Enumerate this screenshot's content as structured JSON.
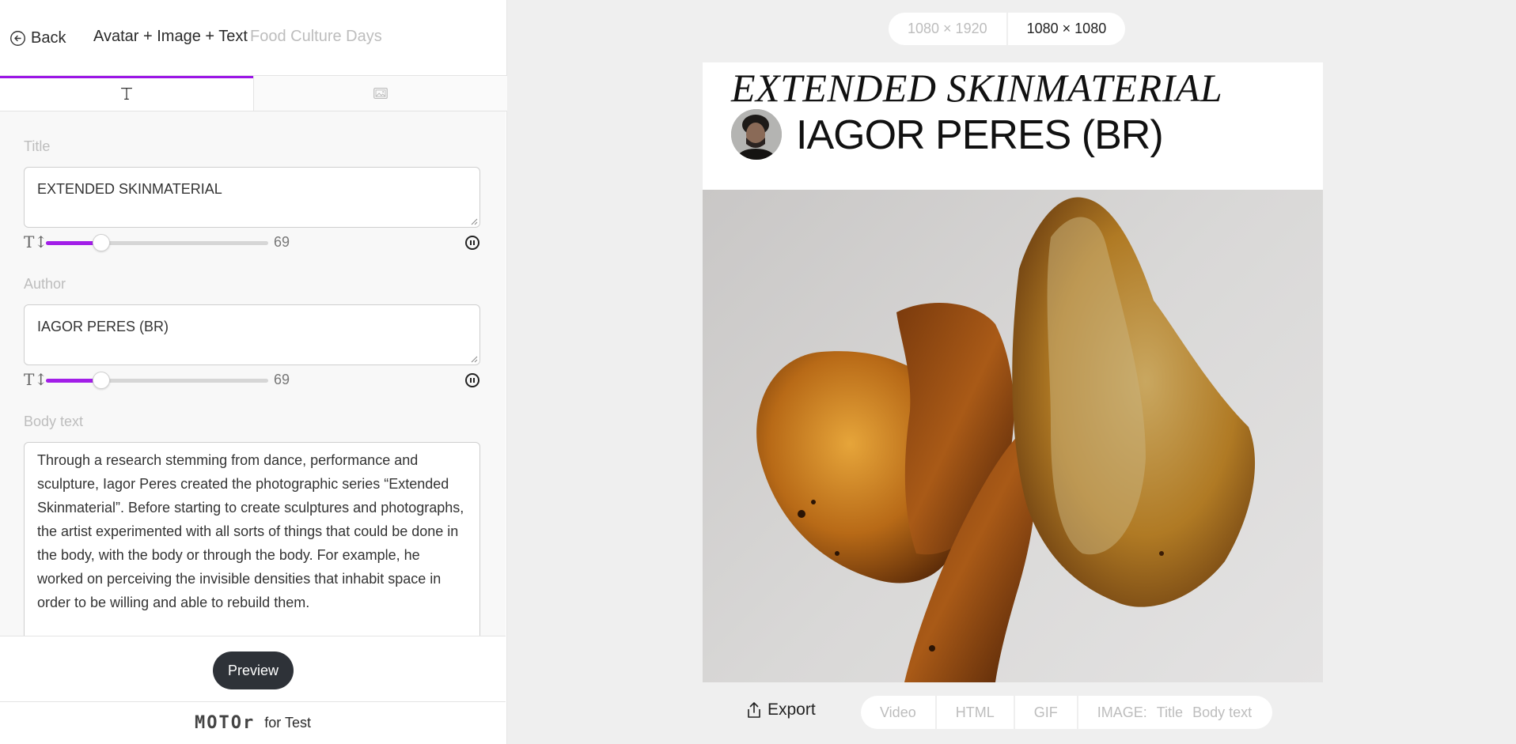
{
  "header": {
    "back_label": "Back",
    "template_name": "Avatar + Image + Text",
    "project_name": "Food Culture Days"
  },
  "tabs": [
    {
      "id": "text",
      "icon": "text-icon",
      "active": true
    },
    {
      "id": "image",
      "icon": "image-icon",
      "active": false
    }
  ],
  "form": {
    "title": {
      "label": "Title",
      "value": "EXTENDED SKINMATERIAL",
      "font_size": 69,
      "slider_fraction": 0.25
    },
    "author": {
      "label": "Author",
      "value": "IAGOR PERES (BR)",
      "font_size": 69,
      "slider_fraction": 0.25
    },
    "body": {
      "label": "Body text",
      "value": "Through a research stemming from dance, performance and sculpture, Iagor Peres created the photographic series “Extended Skinmaterial”. Before starting to create sculptures and photographs, the artist experimented with all sorts of things that could be done in the body, with the body or through the body. For example, he worked on perceiving the invisible densities that inhabit space in order to be willing and able to rebuild them."
    }
  },
  "preview_label": "Preview",
  "brand": {
    "logo": "MOTOr",
    "suffix": "for Test"
  },
  "size_options": [
    {
      "label": "1080 × 1920",
      "active": false
    },
    {
      "label": "1080 × 1080",
      "active": true
    }
  ],
  "canvas": {
    "title": "EXTENDED SKINMATERIAL",
    "author": "IAGOR PERES (BR)"
  },
  "export": {
    "label": "Export",
    "formats": [
      "Video",
      "HTML",
      "GIF"
    ],
    "image_label": "IMAGE:",
    "image_options": [
      "Title",
      "Body text"
    ]
  },
  "colors": {
    "accent": "#9b16e6",
    "dark_button": "#2e3238",
    "muted_text": "#bdbdbd"
  }
}
